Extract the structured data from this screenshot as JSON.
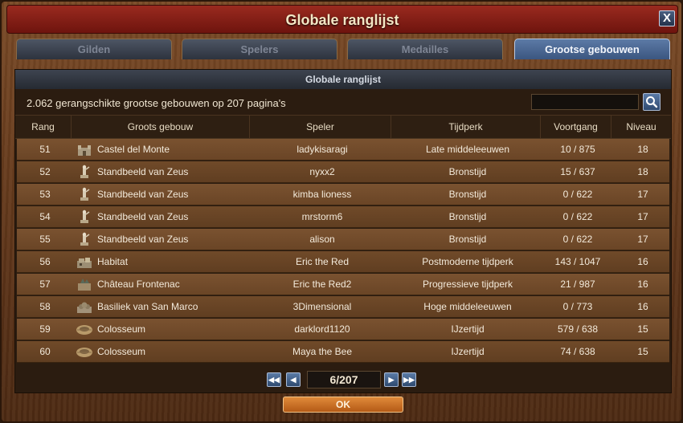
{
  "window": {
    "title": "Globale ranglijst",
    "close_label": "X"
  },
  "tabs": [
    {
      "label": "Gilden",
      "active": false
    },
    {
      "label": "Spelers",
      "active": false
    },
    {
      "label": "Medailles",
      "active": false
    },
    {
      "label": "Grootse gebouwen",
      "active": true
    }
  ],
  "panel": {
    "header": "Globale ranglijst",
    "summary": "2.062 gerangschikte grootse gebouwen op 207 pagina's",
    "search": {
      "value": "",
      "placeholder": ""
    }
  },
  "table": {
    "columns": [
      "Rang",
      "Groots gebouw",
      "Speler",
      "Tijdperk",
      "Voortgang",
      "Niveau"
    ],
    "rows": [
      {
        "rank": "51",
        "building": "Castel del Monte",
        "icon": "castle-icon",
        "player": "ladykisaragi",
        "era": "Late middeleeuwen",
        "progress": "10 / 875",
        "level": "18"
      },
      {
        "rank": "52",
        "building": "Standbeeld van Zeus",
        "icon": "statue-icon",
        "player": "nyxx2",
        "era": "Bronstijd",
        "progress": "15 / 637",
        "level": "18"
      },
      {
        "rank": "53",
        "building": "Standbeeld van Zeus",
        "icon": "statue-icon",
        "player": "kimba lioness",
        "era": "Bronstijd",
        "progress": "0 / 622",
        "level": "17"
      },
      {
        "rank": "54",
        "building": "Standbeeld van Zeus",
        "icon": "statue-icon",
        "player": "mrstorm6",
        "era": "Bronstijd",
        "progress": "0 / 622",
        "level": "17"
      },
      {
        "rank": "55",
        "building": "Standbeeld van Zeus",
        "icon": "statue-icon",
        "player": "alison",
        "era": "Bronstijd",
        "progress": "0 / 622",
        "level": "17"
      },
      {
        "rank": "56",
        "building": "Habitat",
        "icon": "habitat-icon",
        "player": "Eric the Red",
        "era": "Postmoderne tijdperk",
        "progress": "143 / 1047",
        "level": "16"
      },
      {
        "rank": "57",
        "building": "Château Frontenac",
        "icon": "chateau-icon",
        "player": "Eric the Red2",
        "era": "Progressieve tijdperk",
        "progress": "21 / 987",
        "level": "16"
      },
      {
        "rank": "58",
        "building": "Basiliek van San Marco",
        "icon": "basilica-icon",
        "player": "3Dimensional",
        "era": "Hoge middeleeuwen",
        "progress": "0 / 773",
        "level": "16"
      },
      {
        "rank": "59",
        "building": "Colosseum",
        "icon": "colosseum-icon",
        "player": "darklord1120",
        "era": "IJzertijd",
        "progress": "579 / 638",
        "level": "15"
      },
      {
        "rank": "60",
        "building": "Colosseum",
        "icon": "colosseum-icon",
        "player": "Maya the Bee",
        "era": "IJzertijd",
        "progress": "74 / 638",
        "level": "15"
      }
    ]
  },
  "pager": {
    "page_label": "6/207",
    "first_icon": "double-chevron-left-icon",
    "prev_icon": "chevron-left-icon",
    "next_icon": "chevron-right-icon",
    "last_icon": "double-chevron-right-icon"
  },
  "ok_label": "OK"
}
